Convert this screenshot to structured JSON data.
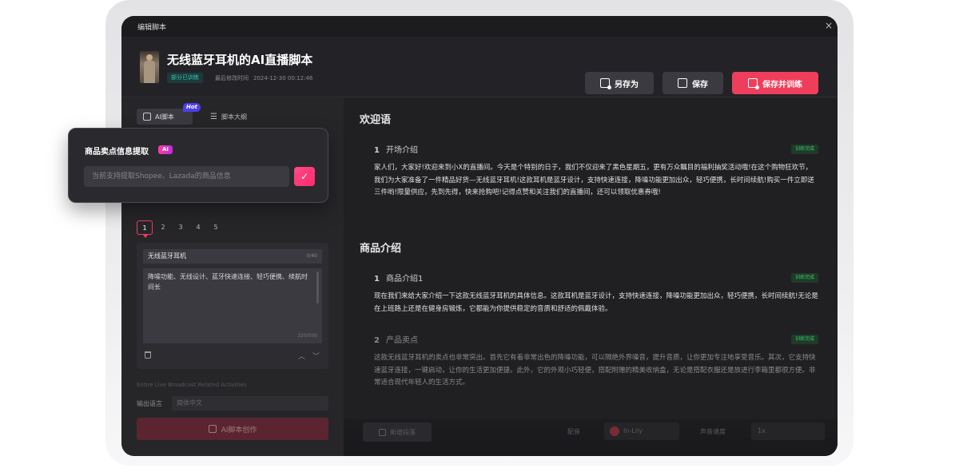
{
  "window": {
    "title": "编辑脚本",
    "close_glyph": "×"
  },
  "header": {
    "doc_title": "无线蓝牙耳机的AI直播脚本",
    "badge": "部分已训练",
    "last_edit_label": "最后修改时间",
    "last_edit_value": "2024-12-30 00:12:46",
    "buttons": {
      "save_as": "另存为",
      "save": "保存",
      "save_and_train": "保存并训练"
    }
  },
  "left_panel": {
    "tabs": {
      "ai_script": "AI脚本",
      "hot_badge": "Hot",
      "outline": "脚本大纲"
    },
    "page_numbers": [
      "1",
      "2",
      "3",
      "4",
      "5"
    ],
    "card": {
      "name_value": "无线蓝牙耳机",
      "name_count": "0/40",
      "desc_value": "降噪功能、无线设计、蓝牙快速连接、轻巧便携、续航时间长",
      "desc_count": "320/500"
    },
    "faded_text": "Entire Live Broadcast Related Activities",
    "language_label": "输出语言",
    "language_value": "简体中文",
    "create_button": "AI脚本创作"
  },
  "popover": {
    "title": "商品卖点信息提取",
    "ai_chip": "AI",
    "placeholder": "当前支持提取Shopee、Lazada的商品信息",
    "confirm_glyph": "✓"
  },
  "sections": [
    {
      "title": "欢迎语",
      "paragraphs": [
        {
          "num": "1",
          "heading": "开场介绍",
          "status": "训练完成",
          "body": "家人们，大家好!欢迎来到小X的直播间。今天是个特别的日子，我们不仅迎来了黑色星期五，更有万众瞩目的福利抽奖活动哦!在这个购物狂欢节，我们为大家准备了一件精品好货—无线蓝牙耳机!这款耳机是蓝牙设计，支持快速连接，降噪功能更加出众，轻巧便携，长时间续航!购买一件立即送三件哟!限量供应，先到先得，快来抢购吧!记得点赞和关注我们的直播间，还可以领取优惠券哦!"
        }
      ]
    },
    {
      "title": "商品介绍",
      "paragraphs": [
        {
          "num": "1",
          "heading": "商品介绍1",
          "status": "训练完成",
          "body": "现在我们来给大家介绍一下这款无线蓝牙耳机的具体信息。这款耳机是蓝牙设计，支持快速连接，降噪功能更加出众，轻巧便携，长时间续航!无论是在上班路上还是在健身房锻炼，它都能为你提供稳定的音质和舒适的佩戴体验。"
        },
        {
          "num": "2",
          "heading": "产品卖点",
          "status": "训练完成",
          "body": "这款无线蓝牙耳机的卖点也非常突出。首先它有着非常出色的降噪功能，可以隔绝外界噪音，提升音质，让你更加专注地享受音乐。其次，它支持快速蓝牙连接，一键启动，让你的生活更加便捷。此外，它的外观小巧轻便，搭配附赠的精美收纳盒，无论是搭配衣服还是放进行李箱里都很方便。非常适合现代年轻人的生活方式。"
        }
      ]
    }
  ],
  "bottom_bar": {
    "add_segment": "新增段落",
    "voice_label": "配音",
    "voice_value": "In-Lily",
    "speed_label": "声音速度",
    "speed_value": "1x"
  }
}
